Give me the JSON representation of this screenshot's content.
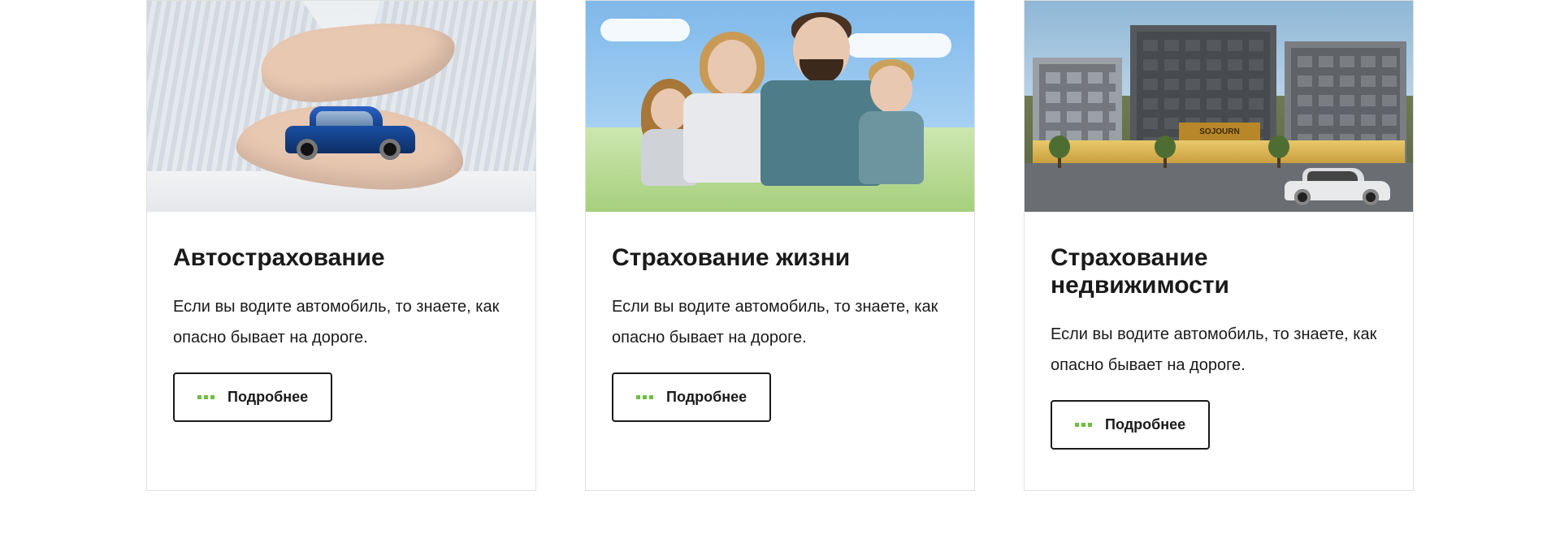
{
  "cards": [
    {
      "title": "Автострахование",
      "desc": "Если вы водите автомобиль, то знаете, как опасно бывает на дороге.",
      "button": "Подробнее"
    },
    {
      "title": "Страхование жизни",
      "desc": "Если вы водите автомобиль, то знаете, как опасно бывает на дороге.",
      "button": "Подробнее"
    },
    {
      "title": "Страхование недвижимости",
      "desc": "Если вы водите автомобиль, то знаете, как опасно бывает на дороге.",
      "button": "Подробнее"
    }
  ],
  "realty_sign": "SOJOURN"
}
